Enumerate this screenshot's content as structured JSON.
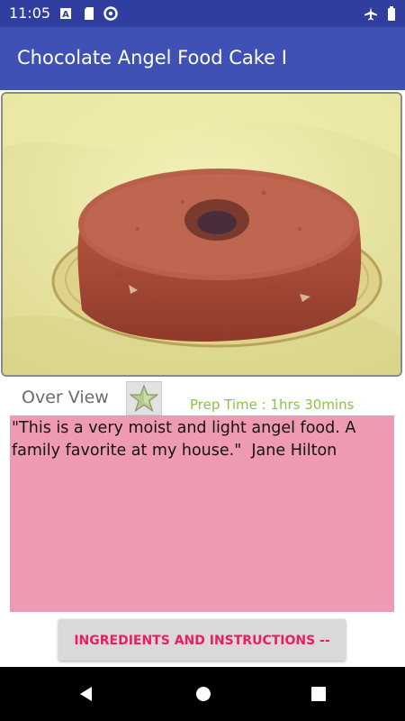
{
  "status_bar": {
    "time": "11:05",
    "left_icons": [
      "a-icon",
      "sd-card-icon",
      "vpn-icon"
    ],
    "right_icons": [
      "airplane-icon",
      "battery-icon"
    ]
  },
  "app_bar": {
    "title": "Chocolate Angel Food Cake I"
  },
  "recipe": {
    "photo_icon": "cake-photo",
    "overview_label": "Over View",
    "favorite_icon": "star-icon",
    "prep_time": "Prep Time :  1hrs 30mins",
    "description": "\"This is a very moist and light angel food. A family favorite at my house.\"  Jane Hilton",
    "ingredients_button": "INGREDIENTS AND INSTRUCTIONS -->>"
  },
  "nav_bar": {
    "icons": [
      "back-icon",
      "home-icon",
      "recents-icon"
    ]
  },
  "colors": {
    "status_bar": "#303f9f",
    "app_bar": "#3f51b5",
    "description_bg": "#ee9ab2",
    "prep_time": "#8bc34a",
    "button_text": "#e91e63"
  }
}
